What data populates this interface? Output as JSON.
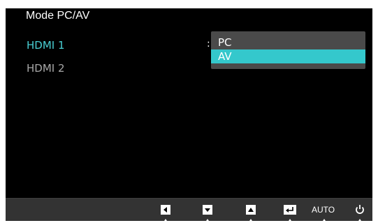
{
  "osd": {
    "title": "Mode PC/AV",
    "menu_items": [
      {
        "label": "HDMI 1",
        "state": "active"
      },
      {
        "label": "HDMI 2",
        "state": "inactive"
      }
    ],
    "separator": ":",
    "dropdown": {
      "options": [
        "PC",
        "AV"
      ],
      "selected": "AV"
    }
  },
  "bottom_bar": {
    "keys": [
      {
        "icon": "left-arrow-icon"
      },
      {
        "icon": "down-arrow-icon"
      },
      {
        "icon": "up-arrow-icon"
      },
      {
        "icon": "enter-icon"
      },
      {
        "label": "AUTO"
      },
      {
        "icon": "power-icon"
      }
    ]
  },
  "colors": {
    "accent": "#34c8cc",
    "active_text": "#49cfd4",
    "inactive_text": "#a8a8a8",
    "background": "#000000",
    "dropdown_bg": "#4a4a4a",
    "bar_bg": "#333333"
  }
}
